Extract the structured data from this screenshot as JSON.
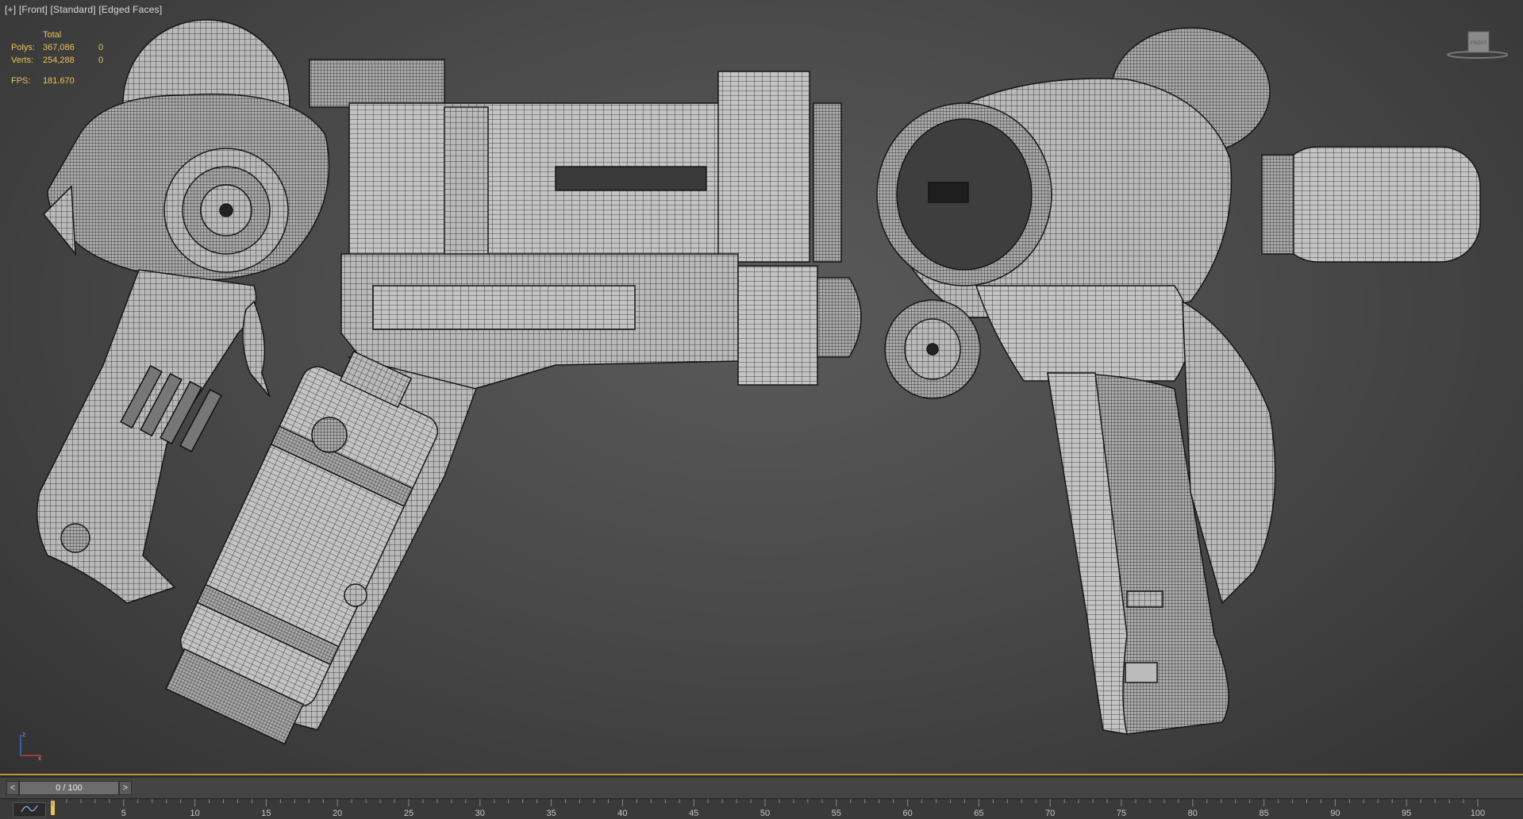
{
  "viewport": {
    "labels": [
      "[+]",
      "[Front]",
      "[Standard]",
      "[Edged Faces]"
    ],
    "viewcube_label": "FRONT"
  },
  "stats": {
    "header": "Total",
    "polys_label": "Polys:",
    "polys_value": "367,086",
    "polys_sel": "0",
    "verts_label": "Verts:",
    "verts_value": "254,288",
    "verts_sel": "0",
    "fps_label": "FPS:",
    "fps_value": "181.670"
  },
  "axis": {
    "z": "z",
    "x": "x"
  },
  "timeslider": {
    "prev": "<",
    "value": "0 / 100",
    "next": ">"
  },
  "trackbar": {
    "curve_icon": "curve-editor-icon",
    "ticks": [
      "5",
      "10",
      "15",
      "20",
      "25",
      "30",
      "35",
      "40",
      "45",
      "50",
      "55",
      "60",
      "65",
      "70",
      "75",
      "80",
      "85",
      "90",
      "95",
      "100"
    ]
  },
  "colors": {
    "viewport_bg": "#4a4a4a",
    "stats_text": "#e8c35a",
    "active_border": "#b99a3a",
    "wire_fill": "#bdbdbd",
    "wire_line": "#1a1a1a"
  }
}
